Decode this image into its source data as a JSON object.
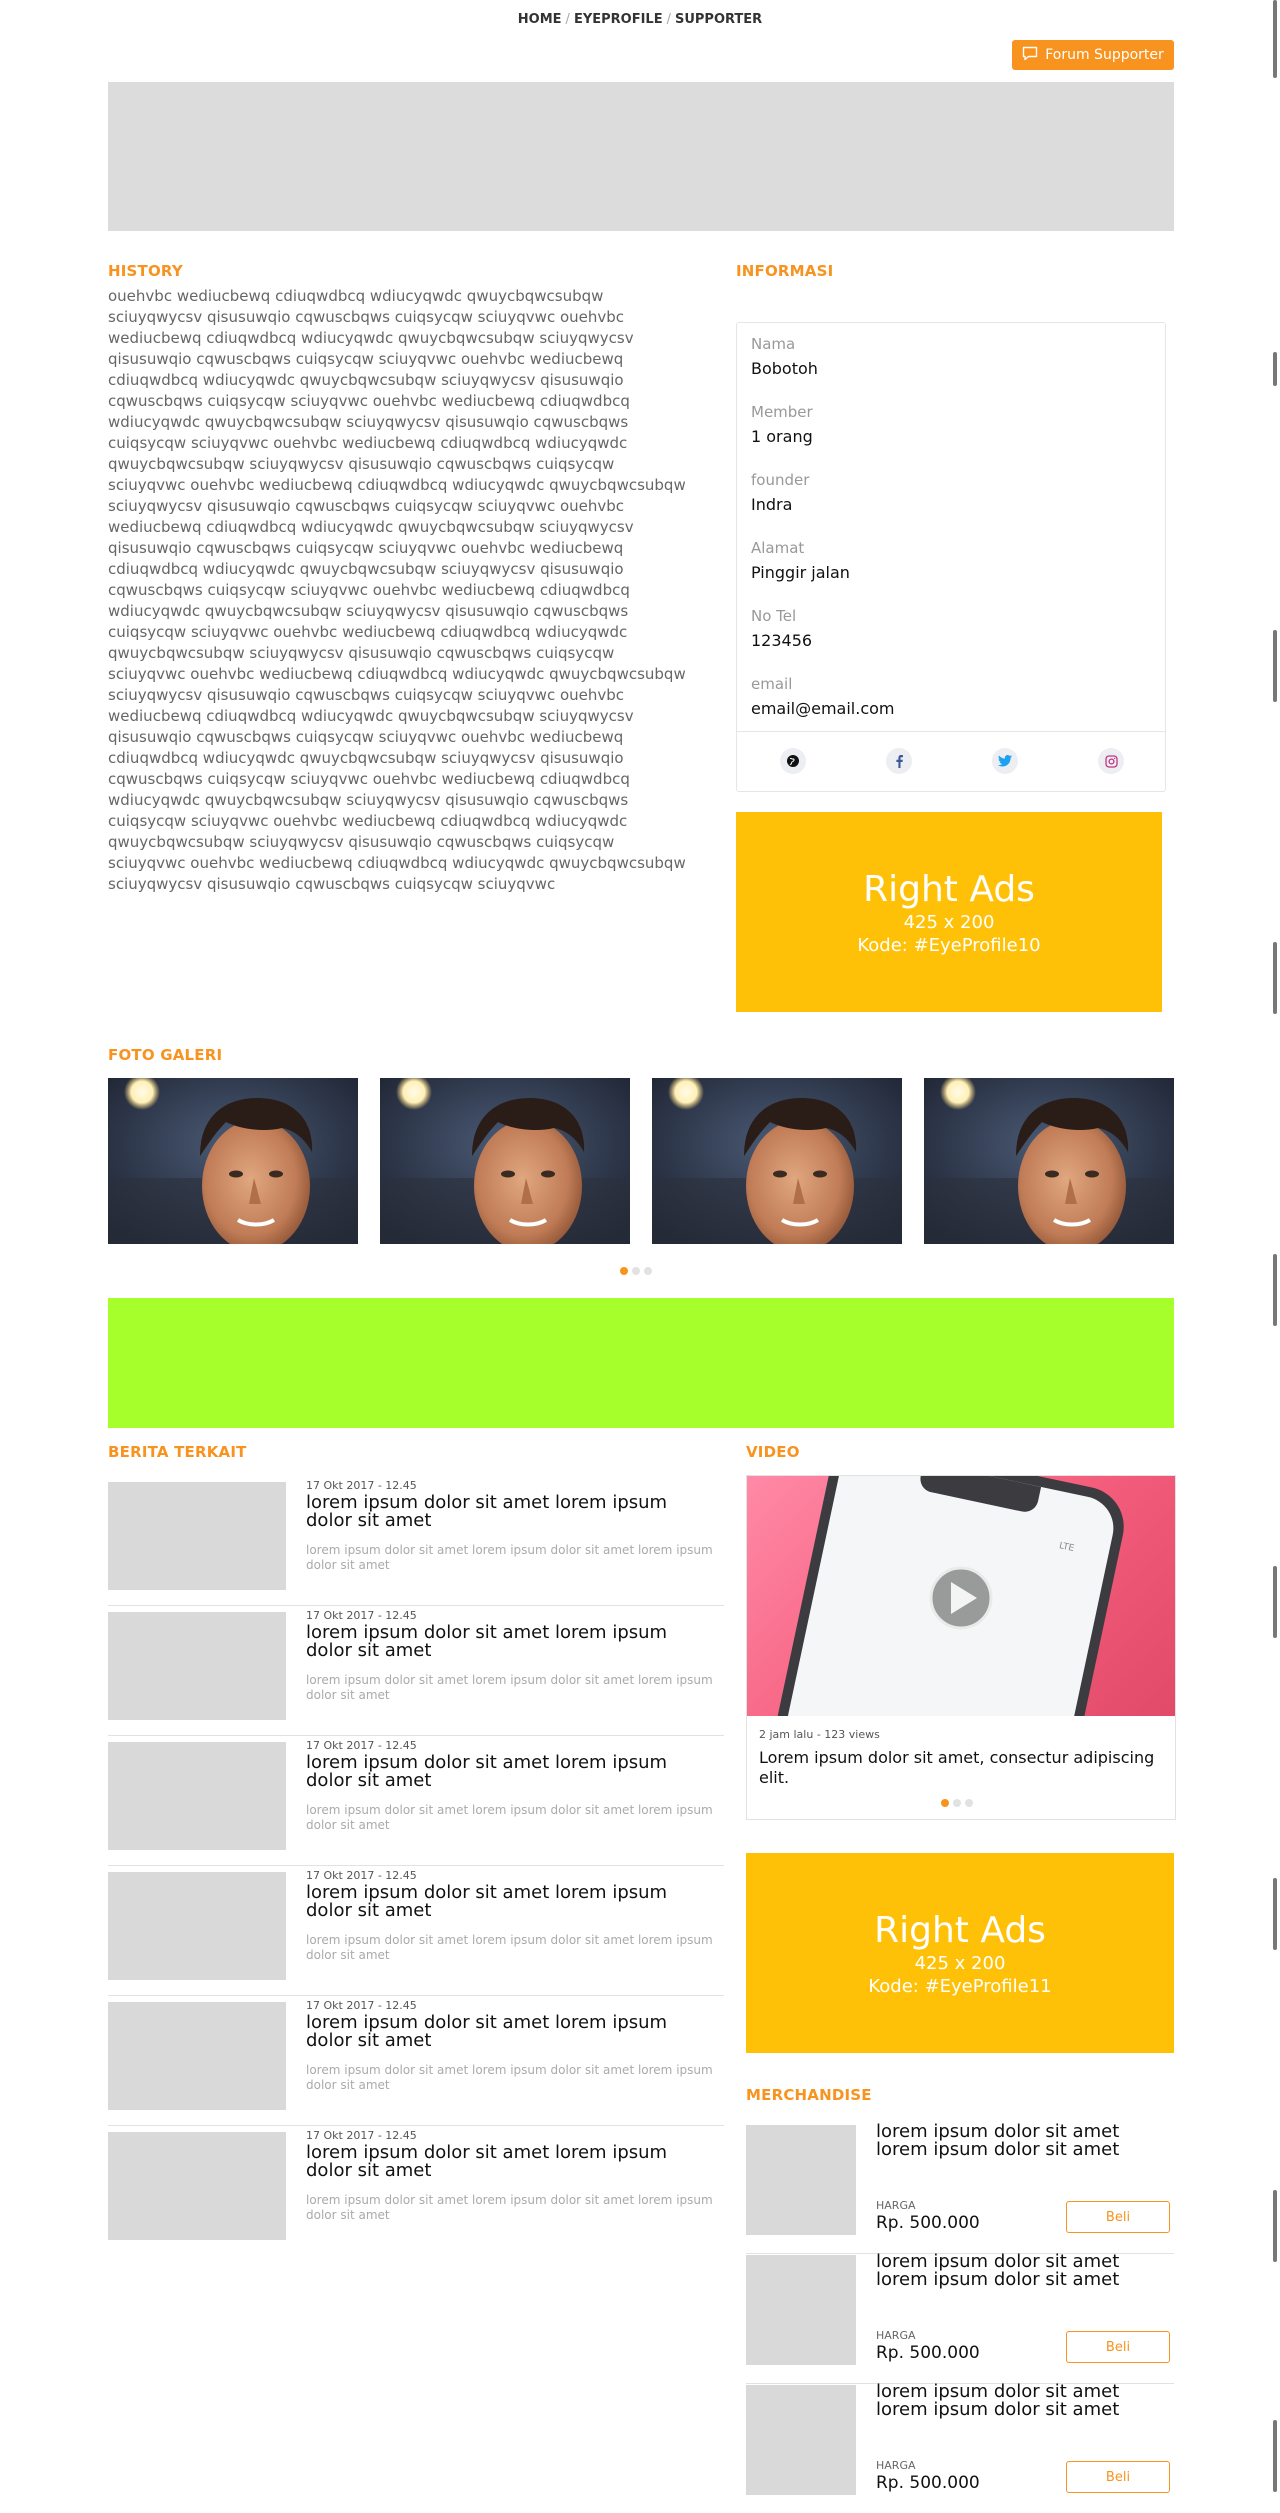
{
  "breadcrumb": {
    "items": [
      "HOME",
      "EYEPROFILE",
      "SUPPORTER"
    ],
    "separator": "/"
  },
  "forum_button": {
    "label": "Forum Supporter",
    "icon": "chat-bubble-icon"
  },
  "history": {
    "title": "HISTORY",
    "text": "ouehvbc wediucbewq cdiuqwdbcq wdiucyqwdc qwuycbqwcsubqw sciuyqwycsv qisusuwqio cqwuscbqws cuiqsycqw sciuyqvwc ouehvbc wediucbewq cdiuqwdbcq wdiucyqwdc qwuycbqwcsubqw sciuyqwycsv qisusuwqio cqwuscbqws cuiqsycqw sciuyqvwc ouehvbc wediucbewq cdiuqwdbcq wdiucyqwdc qwuycbqwcsubqw sciuyqwycsv qisusuwqio cqwuscbqws cuiqsycqw sciuyqvwc ouehvbc wediucbewq cdiuqwdbcq wdiucyqwdc qwuycbqwcsubqw sciuyqwycsv qisusuwqio cqwuscbqws cuiqsycqw sciuyqvwc ouehvbc wediucbewq cdiuqwdbcq wdiucyqwdc qwuycbqwcsubqw sciuyqwycsv qisusuwqio cqwuscbqws cuiqsycqw sciuyqvwc ouehvbc wediucbewq cdiuqwdbcq wdiucyqwdc qwuycbqwcsubqw sciuyqwycsv qisusuwqio cqwuscbqws cuiqsycqw sciuyqvwc ouehvbc wediucbewq cdiuqwdbcq wdiucyqwdc qwuycbqwcsubqw sciuyqwycsv qisusuwqio cqwuscbqws cuiqsycqw sciuyqvwc ouehvbc wediucbewq cdiuqwdbcq wdiucyqwdc qwuycbqwcsubqw sciuyqwycsv qisusuwqio cqwuscbqws cuiqsycqw sciuyqvwc ouehvbc wediucbewq cdiuqwdbcq wdiucyqwdc qwuycbqwcsubqw sciuyqwycsv qisusuwqio cqwuscbqws cuiqsycqw sciuyqvwc ouehvbc wediucbewq cdiuqwdbcq wdiucyqwdc qwuycbqwcsubqw sciuyqwycsv qisusuwqio cqwuscbqws cuiqsycqw sciuyqvwc ouehvbc wediucbewq cdiuqwdbcq wdiucyqwdc qwuycbqwcsubqw sciuyqwycsv qisusuwqio cqwuscbqws cuiqsycqw sciuyqvwc ouehvbc wediucbewq cdiuqwdbcq wdiucyqwdc qwuycbqwcsubqw sciuyqwycsv qisusuwqio cqwuscbqws cuiqsycqw sciuyqvwc ouehvbc wediucbewq cdiuqwdbcq wdiucyqwdc qwuycbqwcsubqw sciuyqwycsv qisusuwqio cqwuscbqws cuiqsycqw sciuyqvwc ouehvbc wediucbewq cdiuqwdbcq wdiucyqwdc qwuycbqwcsubqw sciuyqwycsv qisusuwqio cqwuscbqws cuiqsycqw sciuyqvwc ouehvbc wediucbewq cdiuqwdbcq wdiucyqwdc qwuycbqwcsubqw sciuyqwycsv qisusuwqio cqwuscbqws cuiqsycqw sciuyqvwc ouehvbc wediucbewq cdiuqwdbcq wdiucyqwdc qwuycbqwcsubqw sciuyqwycsv qisusuwqio cqwuscbqws cuiqsycqw sciuyqvwc"
  },
  "informasi": {
    "title": "INFORMASI",
    "fields": [
      {
        "label": "Nama",
        "value": "Bobotoh"
      },
      {
        "label": "Member",
        "value": "1 orang"
      },
      {
        "label": "founder",
        "value": "Indra"
      },
      {
        "label": "Alamat",
        "value": "Pinggir jalan"
      },
      {
        "label": "No Tel",
        "value": "123456"
      },
      {
        "label": "email",
        "value": "email@email.com"
      }
    ],
    "social": [
      {
        "icon": "globe-icon",
        "color": "#111111"
      },
      {
        "icon": "facebook-icon",
        "color": "#3b5998"
      },
      {
        "icon": "twitter-icon",
        "color": "#1da1f2"
      },
      {
        "icon": "instagram-icon",
        "color": "#c13584"
      }
    ]
  },
  "right_ads_1": {
    "title": "Right Ads",
    "size": "425 x 200",
    "code": "Kode: #EyeProfile10",
    "color": "#ffc107"
  },
  "gallery": {
    "title": "FOTO GALERI",
    "images": [
      "photo",
      "photo",
      "photo",
      "photo"
    ],
    "dots": 3,
    "active_dot": 0
  },
  "berita": {
    "title": "BERITA TERKAIT",
    "items": [
      {
        "date": "17 Okt 2017 - 12.45",
        "title": "lorem ipsum dolor sit amet lorem ipsum dolor sit amet",
        "desc": "lorem ipsum dolor sit amet lorem ipsum dolor sit amet lorem ipsum dolor sit amet"
      },
      {
        "date": "17 Okt 2017 - 12.45",
        "title": "lorem ipsum dolor sit amet lorem ipsum dolor sit amet",
        "desc": "lorem ipsum dolor sit amet lorem ipsum dolor sit amet lorem ipsum dolor sit amet"
      },
      {
        "date": "17 Okt 2017 - 12.45",
        "title": "lorem ipsum dolor sit amet lorem ipsum dolor sit amet",
        "desc": "lorem ipsum dolor sit amet lorem ipsum dolor sit amet lorem ipsum dolor sit amet"
      },
      {
        "date": "17 Okt 2017 - 12.45",
        "title": "lorem ipsum dolor sit amet lorem ipsum dolor sit amet",
        "desc": "lorem ipsum dolor sit amet lorem ipsum dolor sit amet lorem ipsum dolor sit amet"
      },
      {
        "date": "17 Okt 2017 - 12.45",
        "title": "lorem ipsum dolor sit amet lorem ipsum dolor sit amet",
        "desc": "lorem ipsum dolor sit amet lorem ipsum dolor sit amet lorem ipsum dolor sit amet"
      },
      {
        "date": "17 Okt 2017 - 12.45",
        "title": "lorem ipsum dolor sit amet lorem ipsum dolor sit amet",
        "desc": "lorem ipsum dolor sit amet lorem ipsum dolor sit amet lorem ipsum dolor sit amet"
      }
    ]
  },
  "video": {
    "title": "VIDEO",
    "meta": "2 jam lalu - 123 views",
    "desc": "Lorem ipsum dolor sit amet, consectur adipiscing elit.",
    "dots": 3,
    "active_dot": 0
  },
  "right_ads_2": {
    "title": "Right Ads",
    "size": "425 x 200",
    "code": "Kode: #EyeProfile11",
    "color": "#ffc107"
  },
  "merchandise": {
    "title": "MERCHANDISE",
    "items": [
      {
        "name": "lorem ipsum dolor sit amet lorem ipsum dolor sit amet",
        "harga_label": "HARGA",
        "price": "Rp. 500.000",
        "button": "Beli"
      },
      {
        "name": "lorem ipsum dolor sit amet lorem ipsum dolor sit amet",
        "harga_label": "HARGA",
        "price": "Rp. 500.000",
        "button": "Beli"
      },
      {
        "name": "lorem ipsum dolor sit amet lorem ipsum dolor sit amet",
        "harga_label": "HARGA",
        "price": "Rp. 500.000",
        "button": "Beli"
      }
    ]
  },
  "colors": {
    "accent": "#f7931e",
    "ads": "#ffc107",
    "green_banner": "#a6ff2a",
    "placeholder": "#d9d9d9"
  }
}
